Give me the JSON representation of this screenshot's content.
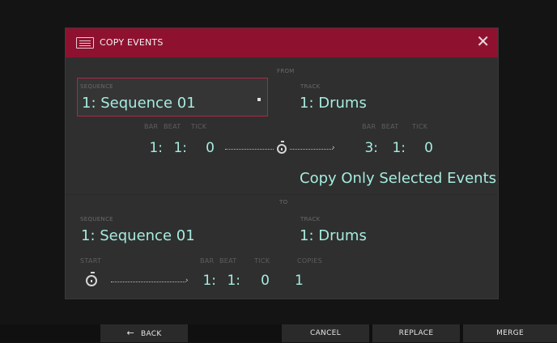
{
  "dialog": {
    "title": "COPY EVENTS",
    "close_glyph": "✕",
    "from_label": "FROM",
    "to_label": "TO"
  },
  "from": {
    "sequence_label": "SEQUENCE",
    "sequence_value": "1: Sequence 01",
    "track_label": "TRACK",
    "track_value": "1: Drums",
    "bar_label": "BAR",
    "beat_label": "BEAT",
    "tick_label": "TICK",
    "start": {
      "bar": "1:",
      "beat": "1:",
      "tick": "0"
    },
    "end": {
      "bar": "3:",
      "beat": "1:",
      "tick": "0"
    },
    "mode_value": "Copy Only Selected Events"
  },
  "to": {
    "sequence_label": "SEQUENCE",
    "sequence_value": "1: Sequence 01",
    "track_label": "TRACK",
    "track_value": "1: Drums",
    "start_label": "START",
    "bar_label": "BAR",
    "beat_label": "BEAT",
    "tick_label": "TICK",
    "copies_label": "COPIES",
    "start": {
      "bar": "1:",
      "beat": "1:",
      "tick": "0"
    },
    "copies_value": "1"
  },
  "footer": {
    "back_arrow": "←",
    "back_label": "BACK",
    "cancel_label": "CANCEL",
    "replace_label": "REPLACE",
    "merge_label": "MERGE"
  },
  "colors": {
    "title_bar": "#8e1230",
    "value_text": "#a6ecdf",
    "selected_border": "#b0273f"
  }
}
